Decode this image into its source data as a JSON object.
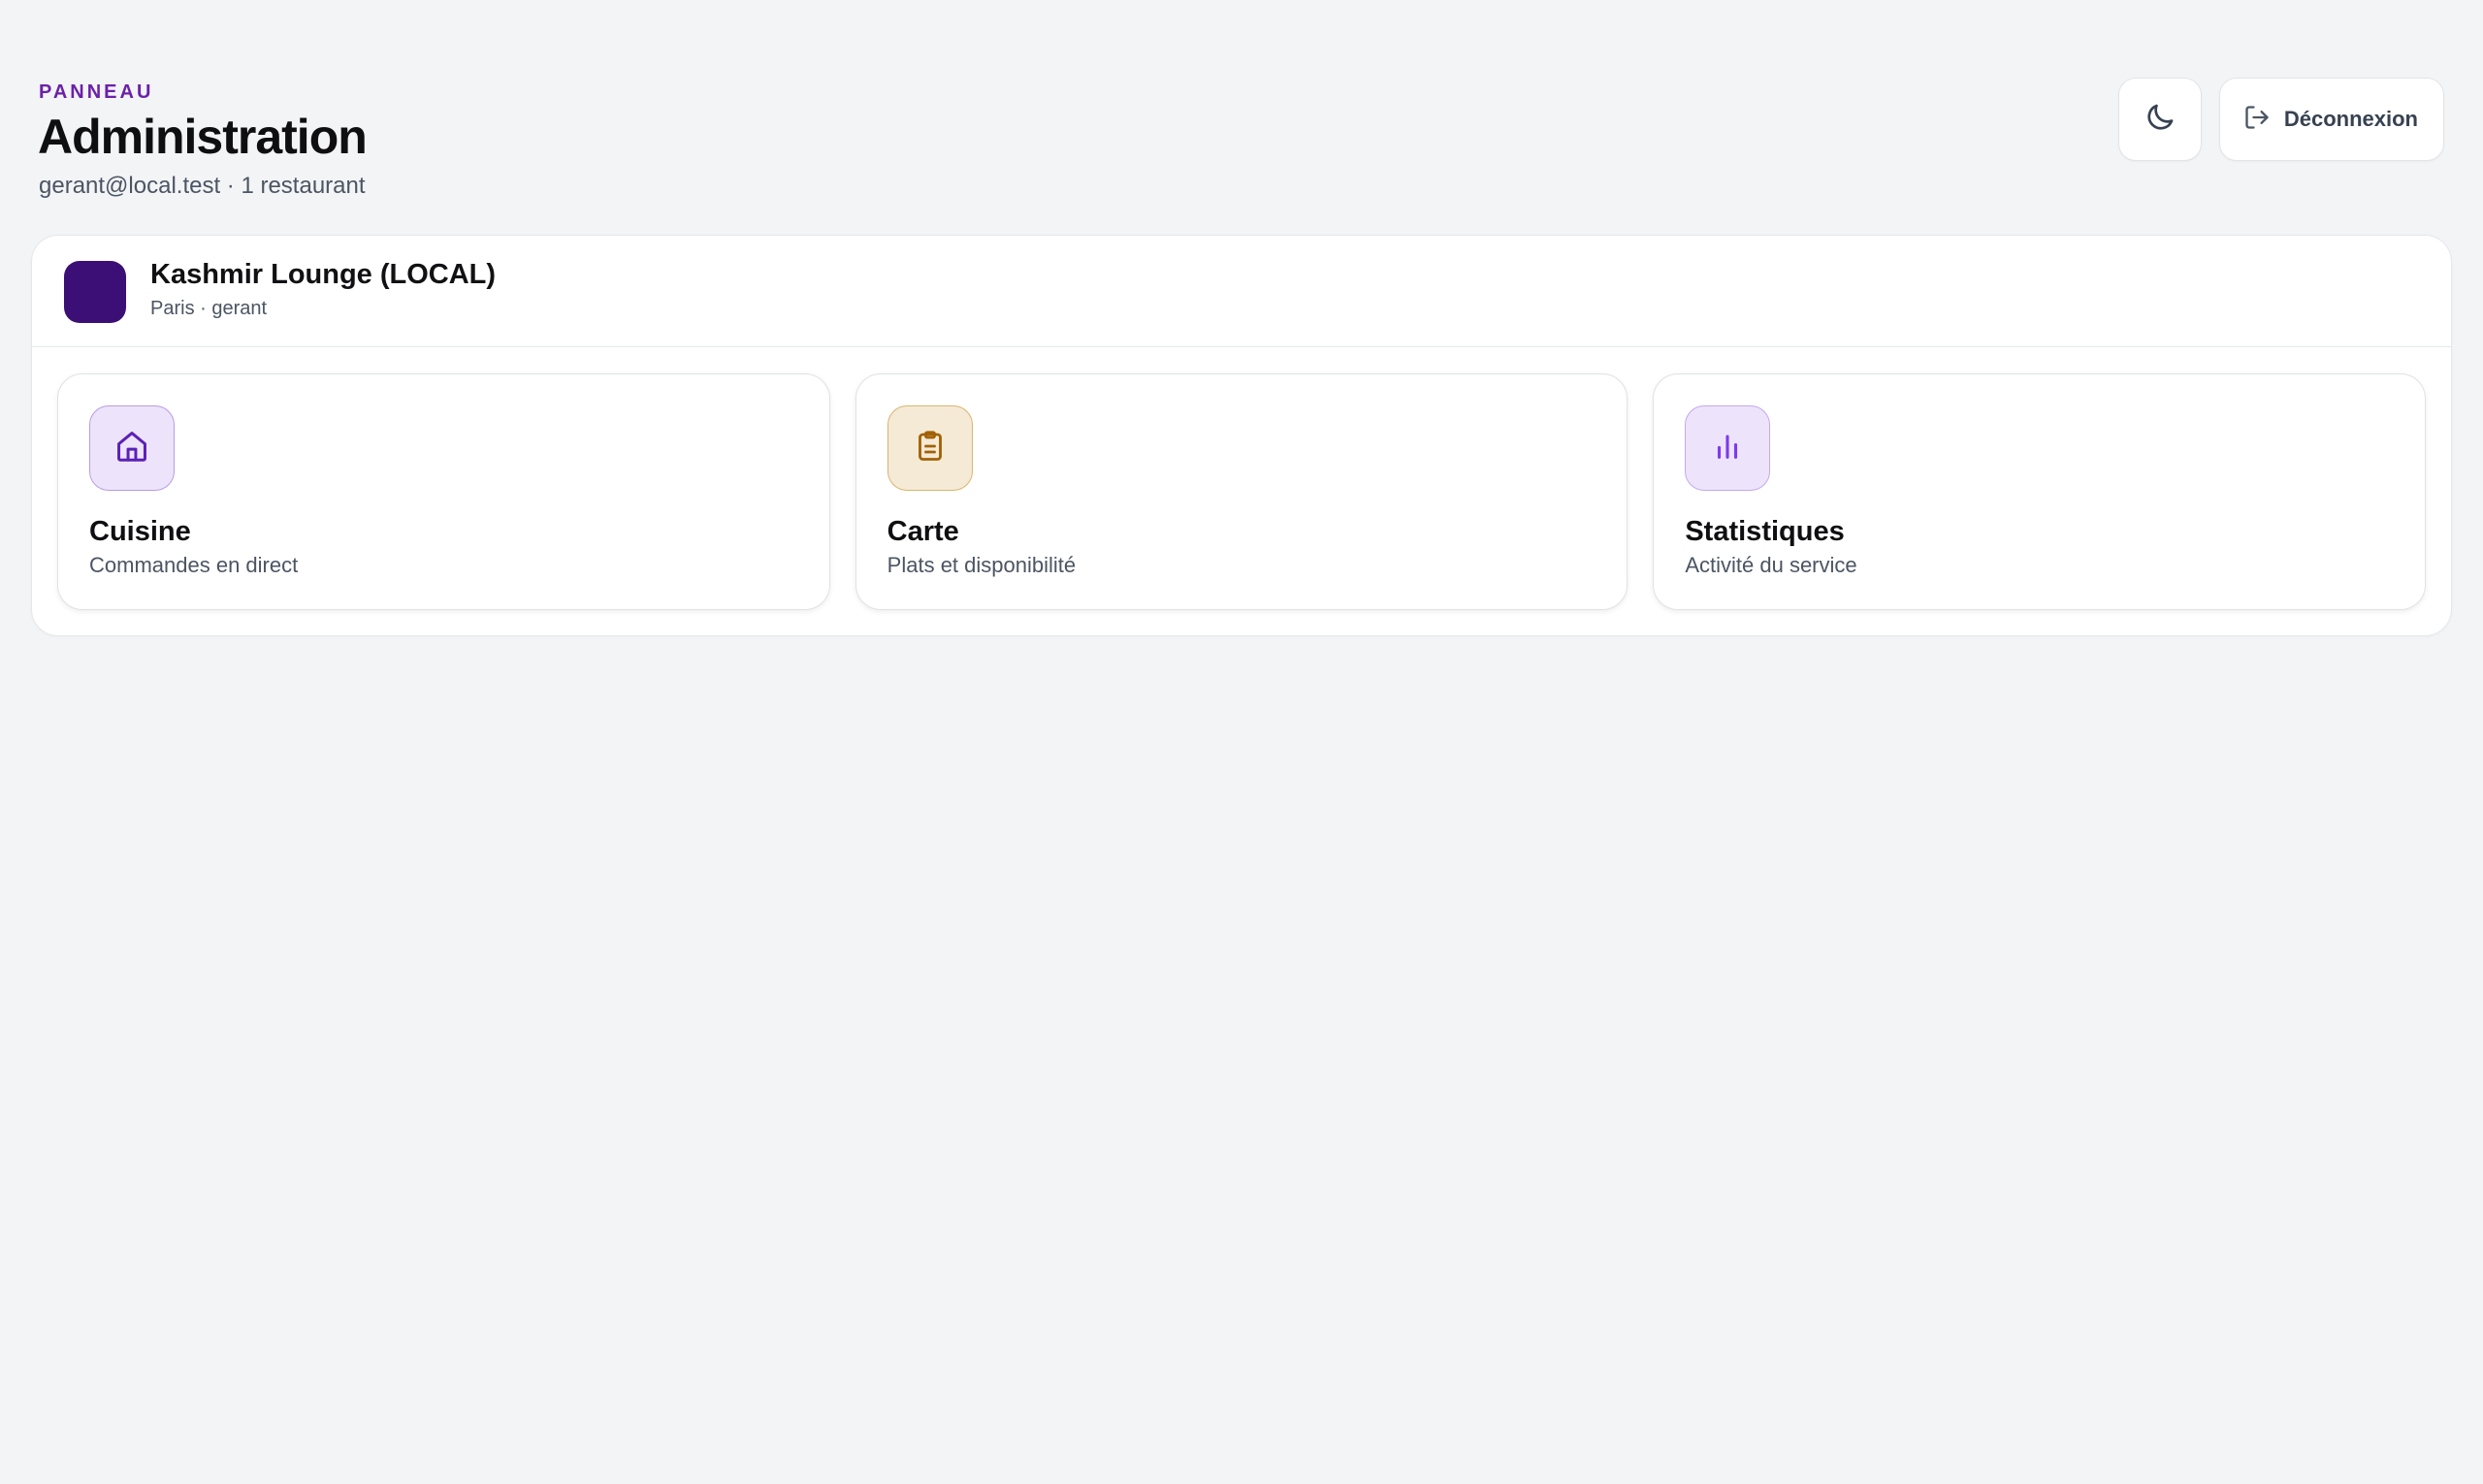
{
  "header": {
    "eyebrow": "PANNEAU",
    "title": "Administration",
    "subtitle": "gerant@local.test · 1 restaurant",
    "theme_toggle_icon": "moon-icon",
    "logout_label": "Déconnexion",
    "logout_icon": "logout-icon"
  },
  "restaurant": {
    "name": "Kashmir Lounge (LOCAL)",
    "meta": "Paris · gerant",
    "avatar_color": "#3b0f75"
  },
  "cards": [
    {
      "title": "Cuisine",
      "description": "Commandes en direct",
      "icon": "home-icon",
      "icon_bg": "#ede4fb",
      "icon_border": "#b89be6",
      "icon_color": "#5b21b6"
    },
    {
      "title": "Carte",
      "description": "Plats et disponibilité",
      "icon": "clipboard-icon",
      "icon_bg": "#f5ead6",
      "icon_border": "#d9b56f",
      "icon_color": "#a16207"
    },
    {
      "title": "Statistiques",
      "description": "Activité du service",
      "icon": "bar-chart-icon",
      "icon_bg": "#ede4fb",
      "icon_border": "#c3a8ef",
      "icon_color": "#7c3aed"
    }
  ],
  "colors": {
    "accent": "#6b21a8",
    "background": "#f3f4f6"
  }
}
